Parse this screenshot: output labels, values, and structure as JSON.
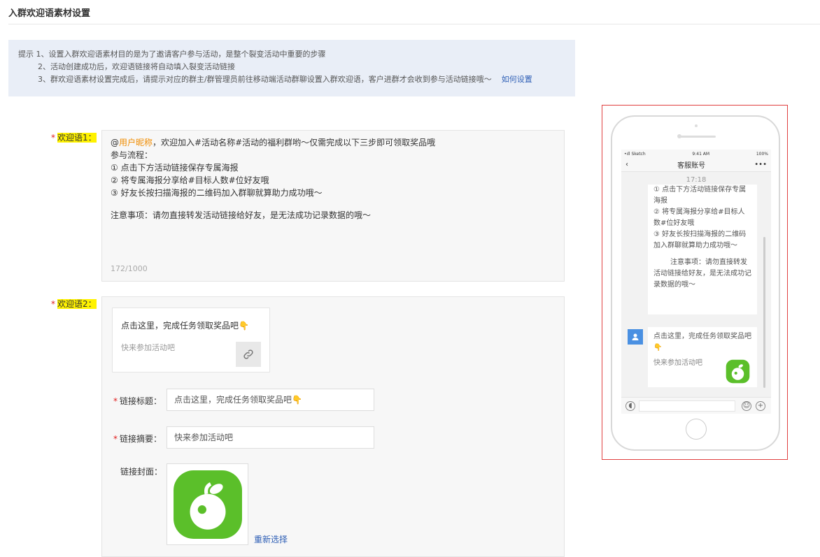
{
  "page": {
    "title": "入群欢迎语素材设置"
  },
  "tips": {
    "label": "提示",
    "line1": "1、设置入群欢迎语素材目的是为了邀请客户参与活动，是整个裂变活动中重要的步骤",
    "line2": "2、活动创建成功后，欢迎语链接将自动填入裂变活动链接",
    "line3": "3、群欢迎语素材设置完成后，请提示对应的群主/群管理员前往移动端活动群聊设置入群欢迎语，客户进群才会收到参与活动链接哦～",
    "link": "如何设置"
  },
  "welcome1": {
    "label": "欢迎语1：",
    "at": "@",
    "user_tag": "用户昵称",
    "line1_rest": "，欢迎加入#活动名称#活动的福利群哟～仅需完成以下三步即可领取奖品哦",
    "line2": "参与流程：",
    "line3": "① 点击下方活动链接保存专属海报",
    "line4": "② 将专属海报分享给#目标人数#位好友哦",
    "line5": "③ 好友长按扫描海报的二维码加入群聊就算助力成功哦～",
    "line6": "注意事项：请勿直接转发活动链接给好友，是无法成功记录数据的哦～",
    "count": "172/1000"
  },
  "welcome2": {
    "label": "欢迎语2：",
    "card_title": "点击这里，完成任务领取奖品吧👇",
    "card_desc": "快来参加活动吧",
    "link_title_label": "链接标题：",
    "link_title_value": "点击这里，完成任务领取奖品吧👇",
    "link_summary_label": "链接摘要：",
    "link_summary_value": "快来参加活动吧",
    "cover_label": "链接封面：",
    "reselect": "重新选择"
  },
  "phone": {
    "carrier": "•ıll Sketch",
    "clock": "9:41 AM",
    "battery": "100%",
    "chat_title": "客服账号",
    "time": "17:18",
    "msg_lines": [
      "① 点击下方活动链接保存专属海报",
      "② 将专属海报分享给#目标人数#位好友哦",
      "③ 好友长按扫描海报的二维码加入群聊就算助力成功哦～",
      "注意事项：请勿直接转发活动链接给好友，是无法成功记录数据的哦～"
    ],
    "card_title": "点击这里，完成任务领取奖品吧👇",
    "card_desc": "快来参加活动吧"
  },
  "colors": {
    "accent": "#2d5eb5",
    "required": "#e02020",
    "highlight": "#fff200",
    "user_tag": "#f08c00",
    "green": "#5bbf2a"
  }
}
